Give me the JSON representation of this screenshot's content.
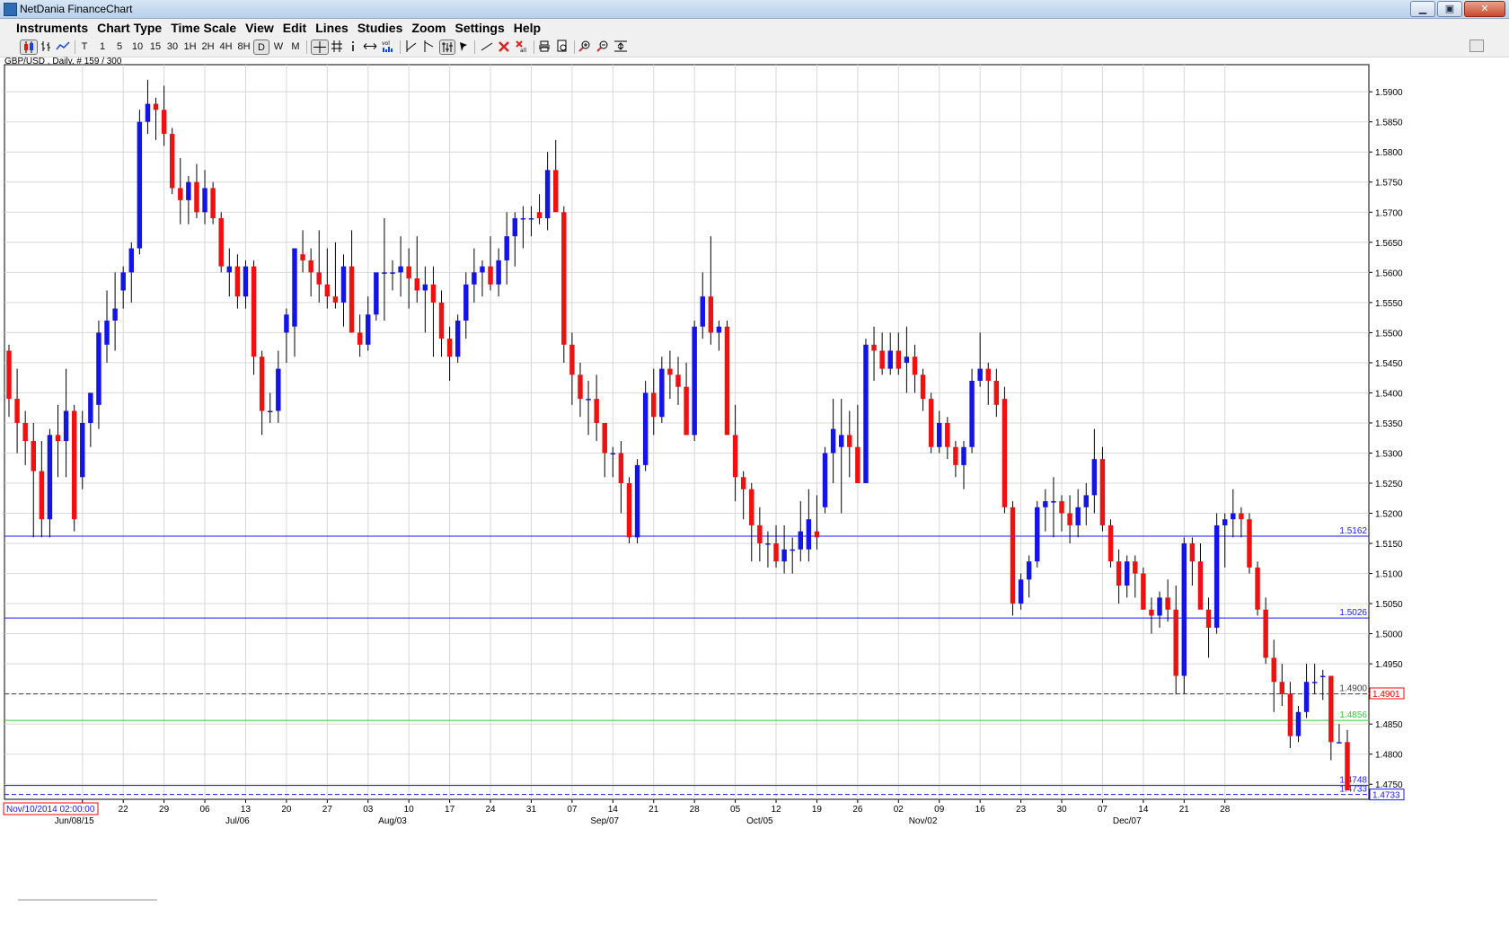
{
  "window": {
    "title": "NetDania FinanceChart",
    "buttons": {
      "minimize": "▁",
      "maximize": "▣",
      "close": "✕"
    }
  },
  "menu": [
    "Instruments",
    "Chart Type",
    "Time Scale",
    "View",
    "Edit",
    "Lines",
    "Studies",
    "Zoom",
    "Settings",
    "Help"
  ],
  "toolbar": {
    "timescales": [
      "T",
      "1",
      "5",
      "10",
      "15",
      "30",
      "1H",
      "2H",
      "4H",
      "8H",
      "D",
      "W",
      "M"
    ],
    "selected_timescale": "D",
    "icons": [
      "candlestick-icon",
      "bar-chart-icon",
      "line-chart-icon",
      "crosshair-icon",
      "grid-icon",
      "info-icon",
      "arrows-icon",
      "volume-icon",
      "trend-line-icon",
      "fib-icon",
      "bar-pattern-icon",
      "cursor-icon",
      "draw-line-icon",
      "delete-icon",
      "delete-all-icon",
      "print-icon",
      "print-preview-icon",
      "zoom-in-icon",
      "zoom-out-icon",
      "zoom-fit-icon"
    ]
  },
  "status_label": "GBP/USD , Daily, # 159 / 300",
  "chart_data": {
    "type": "candlestick",
    "instrument": "GBP/USD",
    "timeframe": "Daily",
    "ylim": [
      1.4725,
      1.5945
    ],
    "y_ticks": [
      "1.5900",
      "1.5850",
      "1.5800",
      "1.5750",
      "1.5700",
      "1.5650",
      "1.5600",
      "1.5550",
      "1.5500",
      "1.5450",
      "1.5400",
      "1.5350",
      "1.5300",
      "1.5250",
      "1.5200",
      "1.5150",
      "1.5100",
      "1.5050",
      "1.5000",
      "1.4950",
      "1.4900",
      "1.4850",
      "1.4800",
      "1.4750"
    ],
    "x_ticks": [
      {
        "i": 9,
        "label": "15"
      },
      {
        "i": 14,
        "label": "22"
      },
      {
        "i": 19,
        "label": "29"
      },
      {
        "i": 24,
        "label": "06"
      },
      {
        "i": 29,
        "label": "13"
      },
      {
        "i": 34,
        "label": "20"
      },
      {
        "i": 39,
        "label": "27"
      },
      {
        "i": 44,
        "label": "03"
      },
      {
        "i": 49,
        "label": "10"
      },
      {
        "i": 54,
        "label": "17"
      },
      {
        "i": 59,
        "label": "24"
      },
      {
        "i": 64,
        "label": "31"
      },
      {
        "i": 69,
        "label": "07"
      },
      {
        "i": 74,
        "label": "14"
      },
      {
        "i": 79,
        "label": "21"
      },
      {
        "i": 84,
        "label": "28"
      },
      {
        "i": 89,
        "label": "05"
      },
      {
        "i": 94,
        "label": "12"
      },
      {
        "i": 99,
        "label": "19"
      },
      {
        "i": 104,
        "label": "26"
      },
      {
        "i": 109,
        "label": "02"
      },
      {
        "i": 114,
        "label": "09"
      },
      {
        "i": 119,
        "label": "16"
      },
      {
        "i": 124,
        "label": "23"
      },
      {
        "i": 129,
        "label": "30"
      },
      {
        "i": 134,
        "label": "07"
      },
      {
        "i": 139,
        "label": "14"
      },
      {
        "i": 144,
        "label": "21"
      },
      {
        "i": 149,
        "label": "28"
      }
    ],
    "month_labels": [
      {
        "i": 8,
        "label": "Jun/08/15"
      },
      {
        "i": 28,
        "label": "Jul/06"
      },
      {
        "i": 47,
        "label": "Aug/03"
      },
      {
        "i": 73,
        "label": "Sep/07"
      },
      {
        "i": 92,
        "label": "Oct/05"
      },
      {
        "i": 112,
        "label": "Nov/02"
      },
      {
        "i": 137,
        "label": "Dec/07"
      }
    ],
    "date_stamp": "Nov/10/2014 02:00:00",
    "hlines": [
      {
        "value": 1.5162,
        "label": "1.5162",
        "color": "#1818ff",
        "style": "solid"
      },
      {
        "value": 1.5026,
        "label": "1.5026",
        "color": "#1818ff",
        "style": "solid"
      },
      {
        "value": 1.49,
        "label": "1.4900",
        "color": "#404040",
        "style": "dashed"
      },
      {
        "value": 1.4856,
        "label": "1.4856",
        "color": "#33cc33",
        "style": "solid"
      },
      {
        "value": 1.4748,
        "label": "1.4748",
        "color": "#1818ff",
        "style": "solid"
      },
      {
        "value": 1.4733,
        "label": "1.4733",
        "color": "#1818ff",
        "style": "dashed"
      }
    ],
    "price_boxes": [
      {
        "value": 1.4901,
        "label": "1.4901",
        "color": "#ff0000"
      },
      {
        "value": 1.4733,
        "label": "1.4733",
        "color": "#1818ff"
      }
    ],
    "colors": {
      "up": "#1414e6",
      "down": "#ee1111",
      "wick": "#000000",
      "grid": "#d8d8d8",
      "axis": "#000000"
    },
    "candles_ohlc": [
      [
        1.547,
        1.548,
        1.536,
        1.539
      ],
      [
        1.539,
        1.544,
        1.53,
        1.535
      ],
      [
        1.535,
        1.537,
        1.528,
        1.532
      ],
      [
        1.532,
        1.535,
        1.516,
        1.527
      ],
      [
        1.527,
        1.532,
        1.516,
        1.519
      ],
      [
        1.519,
        1.534,
        1.516,
        1.533
      ],
      [
        1.533,
        1.538,
        1.526,
        1.532
      ],
      [
        1.532,
        1.544,
        1.526,
        1.537
      ],
      [
        1.537,
        1.538,
        1.517,
        1.519
      ],
      [
        1.526,
        1.537,
        1.524,
        1.535
      ],
      [
        1.535,
        1.54,
        1.531,
        1.54
      ],
      [
        1.538,
        1.552,
        1.534,
        1.55
      ],
      [
        1.548,
        1.557,
        1.545,
        1.552
      ],
      [
        1.552,
        1.56,
        1.547,
        1.554
      ],
      [
        1.557,
        1.561,
        1.554,
        1.56
      ],
      [
        1.56,
        1.565,
        1.555,
        1.564
      ],
      [
        1.564,
        1.587,
        1.563,
        1.585
      ],
      [
        1.585,
        1.592,
        1.583,
        1.588
      ],
      [
        1.588,
        1.589,
        1.582,
        1.587
      ],
      [
        1.587,
        1.591,
        1.581,
        1.583
      ],
      [
        1.583,
        1.584,
        1.573,
        1.574
      ],
      [
        1.574,
        1.579,
        1.568,
        1.572
      ],
      [
        1.572,
        1.576,
        1.568,
        1.575
      ],
      [
        1.575,
        1.578,
        1.569,
        1.57
      ],
      [
        1.57,
        1.577,
        1.568,
        1.574
      ],
      [
        1.574,
        1.575,
        1.568,
        1.569
      ],
      [
        1.569,
        1.57,
        1.56,
        1.561
      ],
      [
        1.56,
        1.564,
        1.556,
        1.561
      ],
      [
        1.561,
        1.563,
        1.554,
        1.556
      ],
      [
        1.556,
        1.562,
        1.554,
        1.561
      ],
      [
        1.561,
        1.562,
        1.543,
        1.546
      ],
      [
        1.546,
        1.547,
        1.533,
        1.537
      ],
      [
        1.537,
        1.54,
        1.535,
        1.537
      ],
      [
        1.537,
        1.547,
        1.535,
        1.544
      ],
      [
        1.55,
        1.554,
        1.545,
        1.553
      ],
      [
        1.551,
        1.564,
        1.546,
        1.564
      ],
      [
        1.563,
        1.567,
        1.56,
        1.562
      ],
      [
        1.562,
        1.564,
        1.556,
        1.56
      ],
      [
        1.56,
        1.567,
        1.555,
        1.558
      ],
      [
        1.558,
        1.564,
        1.554,
        1.556
      ],
      [
        1.556,
        1.565,
        1.554,
        1.555
      ],
      [
        1.555,
        1.563,
        1.551,
        1.561
      ],
      [
        1.561,
        1.567,
        1.55,
        1.55
      ],
      [
        1.55,
        1.553,
        1.546,
        1.548
      ],
      [
        1.548,
        1.556,
        1.547,
        1.553
      ],
      [
        1.553,
        1.559,
        1.552,
        1.56
      ],
      [
        1.56,
        1.569,
        1.552,
        1.56
      ],
      [
        1.56,
        1.562,
        1.557,
        1.56
      ],
      [
        1.56,
        1.566,
        1.556,
        1.561
      ],
      [
        1.561,
        1.564,
        1.554,
        1.559
      ],
      [
        1.559,
        1.566,
        1.555,
        1.557
      ],
      [
        1.557,
        1.561,
        1.55,
        1.558
      ],
      [
        1.558,
        1.561,
        1.546,
        1.555
      ],
      [
        1.555,
        1.557,
        1.546,
        1.549
      ],
      [
        1.549,
        1.551,
        1.542,
        1.546
      ],
      [
        1.546,
        1.553,
        1.545,
        1.552
      ],
      [
        1.552,
        1.56,
        1.549,
        1.558
      ],
      [
        1.558,
        1.564,
        1.555,
        1.56
      ],
      [
        1.56,
        1.562,
        1.556,
        1.561
      ],
      [
        1.561,
        1.566,
        1.557,
        1.558
      ],
      [
        1.558,
        1.564,
        1.556,
        1.562
      ],
      [
        1.562,
        1.57,
        1.558,
        1.566
      ],
      [
        1.566,
        1.57,
        1.561,
        1.569
      ],
      [
        1.569,
        1.571,
        1.564,
        1.569
      ],
      [
        1.569,
        1.571,
        1.566,
        1.569
      ],
      [
        1.57,
        1.573,
        1.568,
        1.569
      ],
      [
        1.569,
        1.58,
        1.567,
        1.577
      ],
      [
        1.577,
        1.582,
        1.572,
        1.57
      ],
      [
        1.57,
        1.571,
        1.545,
        1.548
      ],
      [
        1.548,
        1.55,
        1.538,
        1.543
      ],
      [
        1.543,
        1.545,
        1.536,
        1.539
      ],
      [
        1.539,
        1.542,
        1.533,
        1.539
      ],
      [
        1.539,
        1.543,
        1.532,
        1.535
      ],
      [
        1.535,
        1.535,
        1.526,
        1.53
      ],
      [
        1.53,
        1.531,
        1.526,
        1.53
      ],
      [
        1.53,
        1.532,
        1.52,
        1.525
      ],
      [
        1.525,
        1.526,
        1.515,
        1.516
      ],
      [
        1.516,
        1.529,
        1.515,
        1.528
      ],
      [
        1.528,
        1.542,
        1.527,
        1.54
      ],
      [
        1.54,
        1.544,
        1.533,
        1.536
      ],
      [
        1.536,
        1.546,
        1.535,
        1.544
      ],
      [
        1.544,
        1.547,
        1.539,
        1.543
      ],
      [
        1.543,
        1.546,
        1.538,
        1.541
      ],
      [
        1.541,
        1.545,
        1.533,
        1.533
      ],
      [
        1.533,
        1.552,
        1.532,
        1.551
      ],
      [
        1.551,
        1.56,
        1.549,
        1.556
      ],
      [
        1.556,
        1.566,
        1.548,
        1.55
      ],
      [
        1.55,
        1.552,
        1.547,
        1.551
      ],
      [
        1.551,
        1.552,
        1.534,
        1.533
      ],
      [
        1.533,
        1.538,
        1.522,
        1.526
      ],
      [
        1.526,
        1.527,
        1.519,
        1.524
      ],
      [
        1.524,
        1.525,
        1.512,
        1.518
      ],
      [
        1.518,
        1.521,
        1.512,
        1.515
      ],
      [
        1.515,
        1.517,
        1.511,
        1.515
      ],
      [
        1.515,
        1.518,
        1.511,
        1.512
      ],
      [
        1.512,
        1.518,
        1.51,
        1.514
      ],
      [
        1.514,
        1.516,
        1.51,
        1.514
      ],
      [
        1.514,
        1.522,
        1.512,
        1.517
      ],
      [
        1.514,
        1.524,
        1.512,
        1.519
      ],
      [
        1.517,
        1.523,
        1.514,
        1.516
      ],
      [
        1.521,
        1.531,
        1.52,
        1.53
      ],
      [
        1.53,
        1.539,
        1.525,
        1.534
      ],
      [
        1.531,
        1.539,
        1.52,
        1.533
      ],
      [
        1.533,
        1.537,
        1.526,
        1.531
      ],
      [
        1.531,
        1.538,
        1.527,
        1.525
      ],
      [
        1.525,
        1.549,
        1.525,
        1.548
      ],
      [
        1.548,
        1.551,
        1.542,
        1.547
      ],
      [
        1.547,
        1.55,
        1.543,
        1.544
      ],
      [
        1.544,
        1.55,
        1.543,
        1.547
      ],
      [
        1.547,
        1.55,
        1.543,
        1.544
      ],
      [
        1.545,
        1.551,
        1.54,
        1.546
      ],
      [
        1.546,
        1.548,
        1.54,
        1.543
      ],
      [
        1.543,
        1.544,
        1.537,
        1.539
      ],
      [
        1.539,
        1.54,
        1.53,
        1.531
      ],
      [
        1.531,
        1.537,
        1.53,
        1.535
      ],
      [
        1.535,
        1.536,
        1.529,
        1.531
      ],
      [
        1.531,
        1.532,
        1.526,
        1.528
      ],
      [
        1.528,
        1.532,
        1.524,
        1.531
      ],
      [
        1.531,
        1.544,
        1.53,
        1.542
      ],
      [
        1.542,
        1.55,
        1.541,
        1.544
      ],
      [
        1.544,
        1.545,
        1.538,
        1.542
      ],
      [
        1.542,
        1.544,
        1.536,
        1.538
      ],
      [
        1.539,
        1.541,
        1.52,
        1.521
      ],
      [
        1.521,
        1.522,
        1.503,
        1.505
      ],
      [
        1.505,
        1.51,
        1.504,
        1.509
      ],
      [
        1.509,
        1.513,
        1.506,
        1.512
      ],
      [
        1.512,
        1.522,
        1.511,
        1.521
      ],
      [
        1.521,
        1.524,
        1.517,
        1.522
      ],
      [
        1.522,
        1.526,
        1.516,
        1.522
      ],
      [
        1.522,
        1.523,
        1.517,
        1.52
      ],
      [
        1.52,
        1.523,
        1.515,
        1.518
      ],
      [
        1.518,
        1.524,
        1.516,
        1.521
      ],
      [
        1.521,
        1.525,
        1.518,
        1.523
      ],
      [
        1.523,
        1.534,
        1.52,
        1.529
      ],
      [
        1.529,
        1.531,
        1.517,
        1.518
      ],
      [
        1.518,
        1.519,
        1.511,
        1.512
      ],
      [
        1.512,
        1.514,
        1.505,
        1.508
      ],
      [
        1.508,
        1.513,
        1.506,
        1.512
      ],
      [
        1.512,
        1.513,
        1.506,
        1.51
      ],
      [
        1.51,
        1.511,
        1.504,
        1.504
      ],
      [
        1.504,
        1.506,
        1.5,
        1.503
      ],
      [
        1.503,
        1.507,
        1.501,
        1.506
      ],
      [
        1.506,
        1.509,
        1.502,
        1.504
      ],
      [
        1.504,
        1.508,
        1.49,
        1.493
      ],
      [
        1.493,
        1.516,
        1.49,
        1.515
      ],
      [
        1.515,
        1.516,
        1.508,
        1.512
      ],
      [
        1.512,
        1.515,
        1.507,
        1.504
      ],
      [
        1.504,
        1.506,
        1.496,
        1.501
      ],
      [
        1.501,
        1.52,
        1.5,
        1.518
      ],
      [
        1.518,
        1.52,
        1.511,
        1.519
      ],
      [
        1.519,
        1.524,
        1.516,
        1.52
      ],
      [
        1.52,
        1.521,
        1.516,
        1.519
      ],
      [
        1.519,
        1.52,
        1.51,
        1.511
      ],
      [
        1.511,
        1.512,
        1.503,
        1.504
      ],
      [
        1.504,
        1.506,
        1.495,
        1.496
      ],
      [
        1.496,
        1.499,
        1.487,
        1.492
      ],
      [
        1.492,
        1.495,
        1.488,
        1.49
      ],
      [
        1.49,
        1.492,
        1.481,
        1.483
      ],
      [
        1.483,
        1.488,
        1.482,
        1.487
      ],
      [
        1.487,
        1.495,
        1.486,
        1.492
      ],
      [
        1.492,
        1.495,
        1.49,
        1.492
      ],
      [
        1.493,
        1.494,
        1.489,
        1.493
      ],
      [
        1.493,
        1.493,
        1.479,
        1.482
      ],
      [
        1.482,
        1.485,
        1.482,
        1.482
      ],
      [
        1.482,
        1.484,
        1.474,
        1.474
      ]
    ]
  }
}
